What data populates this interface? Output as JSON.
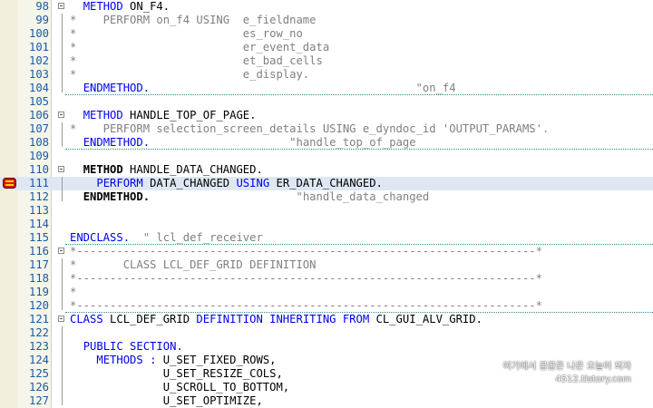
{
  "editor": {
    "lines": [
      {
        "num": "98",
        "tokens": [
          {
            "t": "  ",
            "c": "id"
          },
          {
            "t": "METHOD",
            "c": "kw"
          },
          {
            "t": " ON_F4.",
            "c": "id"
          }
        ]
      },
      {
        "num": "99",
        "tokens": [
          {
            "t": "*    PERFORM on_f4 USING  e_fieldname",
            "c": "cm"
          }
        ]
      },
      {
        "num": "100",
        "tokens": [
          {
            "t": "*                         es_row_no",
            "c": "cm"
          }
        ]
      },
      {
        "num": "101",
        "tokens": [
          {
            "t": "*                         er_event_data",
            "c": "cm"
          }
        ]
      },
      {
        "num": "102",
        "tokens": [
          {
            "t": "*                         et_bad_cells",
            "c": "cm"
          }
        ]
      },
      {
        "num": "103",
        "tokens": [
          {
            "t": "*                         e_display.",
            "c": "cm"
          }
        ]
      },
      {
        "num": "104",
        "tokens": [
          {
            "t": "  ",
            "c": "id"
          },
          {
            "t": "ENDMETHOD.",
            "c": "kw"
          },
          {
            "t": "                                        \"on_f4",
            "c": "cm"
          }
        ]
      },
      {
        "num": "105",
        "tokens": []
      },
      {
        "num": "106",
        "tokens": [
          {
            "t": "  ",
            "c": "id"
          },
          {
            "t": "METHOD",
            "c": "kw"
          },
          {
            "t": " HANDLE_TOP_OF_PAGE.",
            "c": "id"
          }
        ]
      },
      {
        "num": "107",
        "tokens": [
          {
            "t": "*    PERFORM selection_screen_details USING e_dyndoc_id 'OUTPUT_PARAMS'.",
            "c": "cm"
          }
        ]
      },
      {
        "num": "108",
        "tokens": [
          {
            "t": "  ",
            "c": "id"
          },
          {
            "t": "ENDMETHOD.",
            "c": "kw"
          },
          {
            "t": "                     \"handle_top_of_page",
            "c": "cm"
          }
        ]
      },
      {
        "num": "109",
        "tokens": []
      },
      {
        "num": "110",
        "tokens": [
          {
            "t": "  ",
            "c": "id"
          },
          {
            "t": "METHOD",
            "c": "kwb"
          },
          {
            "t": " HANDLE_DATA_CHANGED.",
            "c": "id"
          }
        ]
      },
      {
        "num": "111",
        "tokens": [
          {
            "t": "    ",
            "c": "id"
          },
          {
            "t": "PERFORM",
            "c": "kw"
          },
          {
            "t": " DATA_CHANGED ",
            "c": "id"
          },
          {
            "t": "USING",
            "c": "kw"
          },
          {
            "t": " ER_DATA_CHANGED.",
            "c": "id"
          }
        ]
      },
      {
        "num": "112",
        "tokens": [
          {
            "t": "  ",
            "c": "id"
          },
          {
            "t": "ENDMETHOD.",
            "c": "kwb"
          },
          {
            "t": "                      \"handle_data_changed",
            "c": "cm"
          }
        ]
      },
      {
        "num": "113",
        "tokens": []
      },
      {
        "num": "114",
        "tokens": []
      },
      {
        "num": "115",
        "tokens": [
          {
            "t": "ENDCLASS.",
            "c": "kw"
          },
          {
            "t": "  \" lcl_def_receiver",
            "c": "cm"
          }
        ]
      },
      {
        "num": "116",
        "tokens": [
          {
            "t": "*---------------------------------------------------------------------*",
            "c": "cm"
          }
        ]
      },
      {
        "num": "117",
        "tokens": [
          {
            "t": "*       CLASS LCL_DEF_GRID DEFINITION",
            "c": "cm"
          }
        ]
      },
      {
        "num": "118",
        "tokens": [
          {
            "t": "*---------------------------------------------------------------------*",
            "c": "cm"
          }
        ]
      },
      {
        "num": "119",
        "tokens": [
          {
            "t": "*",
            "c": "cm"
          }
        ]
      },
      {
        "num": "120",
        "tokens": [
          {
            "t": "*---------------------------------------------------------------------*",
            "c": "cm"
          }
        ]
      },
      {
        "num": "121",
        "tokens": [
          {
            "t": "CLASS",
            "c": "kw"
          },
          {
            "t": " LCL_DEF_GRID ",
            "c": "id"
          },
          {
            "t": "DEFINITION INHERITING FROM",
            "c": "kw"
          },
          {
            "t": " CL_GUI_ALV_GRID.",
            "c": "id"
          }
        ]
      },
      {
        "num": "122",
        "tokens": []
      },
      {
        "num": "123",
        "tokens": [
          {
            "t": "  ",
            "c": "id"
          },
          {
            "t": "PUBLIC SECTION.",
            "c": "kw"
          }
        ]
      },
      {
        "num": "124",
        "tokens": [
          {
            "t": "    ",
            "c": "id"
          },
          {
            "t": "METHODS",
            "c": "kw"
          },
          {
            "t": " ",
            "c": "id"
          },
          {
            "t": ":",
            "c": "sb"
          },
          {
            "t": " U_SET_FIXED_ROWS,",
            "c": "id"
          }
        ]
      },
      {
        "num": "125",
        "tokens": [
          {
            "t": "              U_SET_RESIZE_COLS,",
            "c": "id"
          }
        ]
      },
      {
        "num": "126",
        "tokens": [
          {
            "t": "              U_SCROLL_TO_BOTTOM,",
            "c": "id"
          }
        ]
      },
      {
        "num": "127",
        "tokens": [
          {
            "t": "              U_SET_OPTIMIZE,",
            "c": "id"
          }
        ]
      }
    ]
  },
  "watermark": {
    "line1": "여기에서 꿈꿈은 나은 오늘이 되자",
    "line2": "4512.tistory.com"
  },
  "colors": {
    "keyword": "#0000ee",
    "comment": "#808080",
    "line_number": "#1a5aa3",
    "highlight": "#dfe8f2",
    "separator": "#2e8b8b",
    "gutter": "#f2f0dc"
  },
  "icons": {
    "breakpoint": "breakpoint-icon",
    "fold": "fold-toggle-icon"
  }
}
